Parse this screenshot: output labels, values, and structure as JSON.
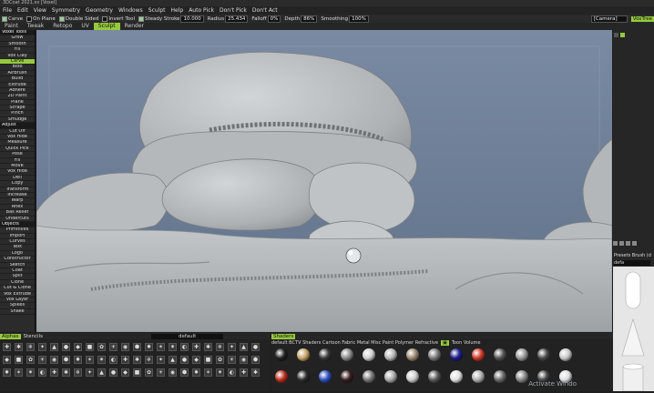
{
  "window": {
    "title": "3DCoat 2021.xx [Voxel]"
  },
  "menu": [
    "File",
    "Edit",
    "View",
    "Symmetry",
    "Geometry",
    "Windows",
    "Sculpt",
    "Help",
    "Auto Pick",
    "Don't Pick",
    "Don't Act"
  ],
  "toolbar": {
    "brush": "Carve",
    "on_plane": "On Plane",
    "double_sided": "Double Sided",
    "invert_tool": "Invert Tool",
    "steady_stroke_label": "Steady Stroke",
    "steady_stroke_value": "10.000",
    "radius_label": "Radius",
    "radius_value": "25.434",
    "falloff_label": "Falloff",
    "falloff_value": "0%",
    "depth_label": "Depth",
    "depth_value": "86%",
    "smoothing_label": "Smoothing",
    "smoothing_value": "100%",
    "camera": "[Camera]",
    "voxtree": "VoxTree"
  },
  "tabs": [
    "Paint",
    "Tweak",
    "Retopo",
    "UV",
    "Sculpt",
    "Render"
  ],
  "active_tab": "Sculpt",
  "left_tools": [
    {
      "label": "Voxel Tools",
      "type": "hdr"
    },
    {
      "label": "Grow"
    },
    {
      "label": "Smooth"
    },
    {
      "label": "Fill"
    },
    {
      "label": "Vox Clay"
    },
    {
      "label": "Carve",
      "type": "sel"
    },
    {
      "label": "Blob"
    },
    {
      "label": "Airbrush"
    },
    {
      "label": "Build"
    },
    {
      "label": "Extrude"
    },
    {
      "label": "Adhere"
    },
    {
      "label": "2D Paint"
    },
    {
      "label": "Plane"
    },
    {
      "label": "Scrape"
    },
    {
      "label": "Pinch"
    },
    {
      "label": "Smudge"
    },
    {
      "label": "Adjust",
      "type": "hdr"
    },
    {
      "label": "Cut Off"
    },
    {
      "label": "Vox Hide"
    },
    {
      "label": "Measure"
    },
    {
      "label": "Quick Pick"
    },
    {
      "label": "Pose"
    },
    {
      "label": "Fill"
    },
    {
      "label": "Move"
    },
    {
      "label": "Vox Hide"
    },
    {
      "label": "Dell"
    },
    {
      "label": "Copy"
    },
    {
      "label": "Transform"
    },
    {
      "label": "Increase"
    },
    {
      "label": "Warp"
    },
    {
      "label": "Anex"
    },
    {
      "label": "Bas Relief"
    },
    {
      "label": "Undercuts"
    },
    {
      "label": "Objects",
      "type": "hdr"
    },
    {
      "label": "Primitives"
    },
    {
      "label": "Import"
    },
    {
      "label": "Curves"
    },
    {
      "label": "Text"
    },
    {
      "label": "Logo"
    },
    {
      "label": "Constructor"
    },
    {
      "label": "Sketch"
    },
    {
      "label": "Coat"
    },
    {
      "label": "Split"
    },
    {
      "label": "Clone"
    },
    {
      "label": "Cut & Clone"
    },
    {
      "label": "Vox Extrude"
    },
    {
      "label": "Vox Layer"
    },
    {
      "label": "Spikes"
    },
    {
      "label": "Snake"
    }
  ],
  "alphas": {
    "tab": "Alphas",
    "tab2": "Stencils",
    "preset": "default"
  },
  "shaders": {
    "tab": "Shaders",
    "categories": "default BCTV Shaders Cartoon Fabric Metal Misc Paint Polymer Refractive",
    "toon": "Toon Volume"
  },
  "right_panel": {
    "presets": "Presets Brush (d",
    "preset_name": "defa"
  },
  "watermark": "Activate Windo",
  "colors": {
    "accent": "#96c93d",
    "sky": "#6f819b",
    "rock": "#b8bbbd"
  }
}
